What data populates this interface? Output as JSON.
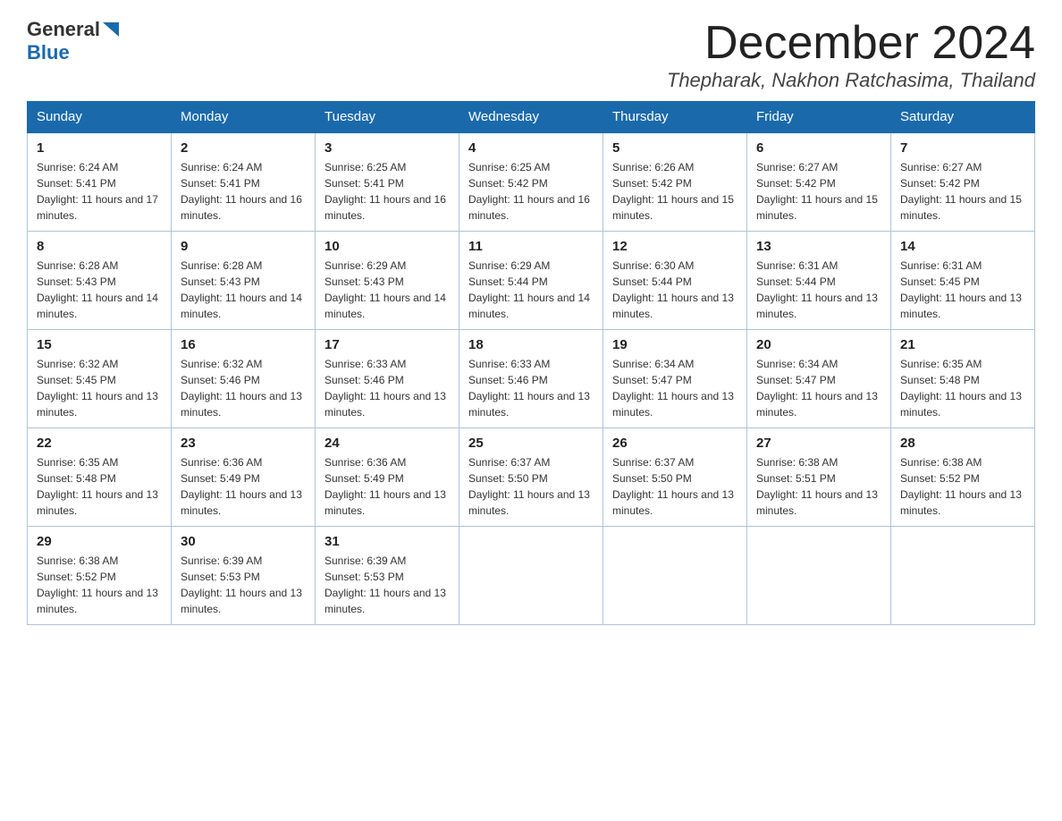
{
  "header": {
    "logo_general": "General",
    "logo_blue": "Blue",
    "month_title": "December 2024",
    "location": "Thepharak, Nakhon Ratchasima, Thailand"
  },
  "days_of_week": [
    "Sunday",
    "Monday",
    "Tuesday",
    "Wednesday",
    "Thursday",
    "Friday",
    "Saturday"
  ],
  "weeks": [
    [
      {
        "num": "1",
        "sunrise": "Sunrise: 6:24 AM",
        "sunset": "Sunset: 5:41 PM",
        "daylight": "Daylight: 11 hours and 17 minutes."
      },
      {
        "num": "2",
        "sunrise": "Sunrise: 6:24 AM",
        "sunset": "Sunset: 5:41 PM",
        "daylight": "Daylight: 11 hours and 16 minutes."
      },
      {
        "num": "3",
        "sunrise": "Sunrise: 6:25 AM",
        "sunset": "Sunset: 5:41 PM",
        "daylight": "Daylight: 11 hours and 16 minutes."
      },
      {
        "num": "4",
        "sunrise": "Sunrise: 6:25 AM",
        "sunset": "Sunset: 5:42 PM",
        "daylight": "Daylight: 11 hours and 16 minutes."
      },
      {
        "num": "5",
        "sunrise": "Sunrise: 6:26 AM",
        "sunset": "Sunset: 5:42 PM",
        "daylight": "Daylight: 11 hours and 15 minutes."
      },
      {
        "num": "6",
        "sunrise": "Sunrise: 6:27 AM",
        "sunset": "Sunset: 5:42 PM",
        "daylight": "Daylight: 11 hours and 15 minutes."
      },
      {
        "num": "7",
        "sunrise": "Sunrise: 6:27 AM",
        "sunset": "Sunset: 5:42 PM",
        "daylight": "Daylight: 11 hours and 15 minutes."
      }
    ],
    [
      {
        "num": "8",
        "sunrise": "Sunrise: 6:28 AM",
        "sunset": "Sunset: 5:43 PM",
        "daylight": "Daylight: 11 hours and 14 minutes."
      },
      {
        "num": "9",
        "sunrise": "Sunrise: 6:28 AM",
        "sunset": "Sunset: 5:43 PM",
        "daylight": "Daylight: 11 hours and 14 minutes."
      },
      {
        "num": "10",
        "sunrise": "Sunrise: 6:29 AM",
        "sunset": "Sunset: 5:43 PM",
        "daylight": "Daylight: 11 hours and 14 minutes."
      },
      {
        "num": "11",
        "sunrise": "Sunrise: 6:29 AM",
        "sunset": "Sunset: 5:44 PM",
        "daylight": "Daylight: 11 hours and 14 minutes."
      },
      {
        "num": "12",
        "sunrise": "Sunrise: 6:30 AM",
        "sunset": "Sunset: 5:44 PM",
        "daylight": "Daylight: 11 hours and 13 minutes."
      },
      {
        "num": "13",
        "sunrise": "Sunrise: 6:31 AM",
        "sunset": "Sunset: 5:44 PM",
        "daylight": "Daylight: 11 hours and 13 minutes."
      },
      {
        "num": "14",
        "sunrise": "Sunrise: 6:31 AM",
        "sunset": "Sunset: 5:45 PM",
        "daylight": "Daylight: 11 hours and 13 minutes."
      }
    ],
    [
      {
        "num": "15",
        "sunrise": "Sunrise: 6:32 AM",
        "sunset": "Sunset: 5:45 PM",
        "daylight": "Daylight: 11 hours and 13 minutes."
      },
      {
        "num": "16",
        "sunrise": "Sunrise: 6:32 AM",
        "sunset": "Sunset: 5:46 PM",
        "daylight": "Daylight: 11 hours and 13 minutes."
      },
      {
        "num": "17",
        "sunrise": "Sunrise: 6:33 AM",
        "sunset": "Sunset: 5:46 PM",
        "daylight": "Daylight: 11 hours and 13 minutes."
      },
      {
        "num": "18",
        "sunrise": "Sunrise: 6:33 AM",
        "sunset": "Sunset: 5:46 PM",
        "daylight": "Daylight: 11 hours and 13 minutes."
      },
      {
        "num": "19",
        "sunrise": "Sunrise: 6:34 AM",
        "sunset": "Sunset: 5:47 PM",
        "daylight": "Daylight: 11 hours and 13 minutes."
      },
      {
        "num": "20",
        "sunrise": "Sunrise: 6:34 AM",
        "sunset": "Sunset: 5:47 PM",
        "daylight": "Daylight: 11 hours and 13 minutes."
      },
      {
        "num": "21",
        "sunrise": "Sunrise: 6:35 AM",
        "sunset": "Sunset: 5:48 PM",
        "daylight": "Daylight: 11 hours and 13 minutes."
      }
    ],
    [
      {
        "num": "22",
        "sunrise": "Sunrise: 6:35 AM",
        "sunset": "Sunset: 5:48 PM",
        "daylight": "Daylight: 11 hours and 13 minutes."
      },
      {
        "num": "23",
        "sunrise": "Sunrise: 6:36 AM",
        "sunset": "Sunset: 5:49 PM",
        "daylight": "Daylight: 11 hours and 13 minutes."
      },
      {
        "num": "24",
        "sunrise": "Sunrise: 6:36 AM",
        "sunset": "Sunset: 5:49 PM",
        "daylight": "Daylight: 11 hours and 13 minutes."
      },
      {
        "num": "25",
        "sunrise": "Sunrise: 6:37 AM",
        "sunset": "Sunset: 5:50 PM",
        "daylight": "Daylight: 11 hours and 13 minutes."
      },
      {
        "num": "26",
        "sunrise": "Sunrise: 6:37 AM",
        "sunset": "Sunset: 5:50 PM",
        "daylight": "Daylight: 11 hours and 13 minutes."
      },
      {
        "num": "27",
        "sunrise": "Sunrise: 6:38 AM",
        "sunset": "Sunset: 5:51 PM",
        "daylight": "Daylight: 11 hours and 13 minutes."
      },
      {
        "num": "28",
        "sunrise": "Sunrise: 6:38 AM",
        "sunset": "Sunset: 5:52 PM",
        "daylight": "Daylight: 11 hours and 13 minutes."
      }
    ],
    [
      {
        "num": "29",
        "sunrise": "Sunrise: 6:38 AM",
        "sunset": "Sunset: 5:52 PM",
        "daylight": "Daylight: 11 hours and 13 minutes."
      },
      {
        "num": "30",
        "sunrise": "Sunrise: 6:39 AM",
        "sunset": "Sunset: 5:53 PM",
        "daylight": "Daylight: 11 hours and 13 minutes."
      },
      {
        "num": "31",
        "sunrise": "Sunrise: 6:39 AM",
        "sunset": "Sunset: 5:53 PM",
        "daylight": "Daylight: 11 hours and 13 minutes."
      },
      null,
      null,
      null,
      null
    ]
  ]
}
